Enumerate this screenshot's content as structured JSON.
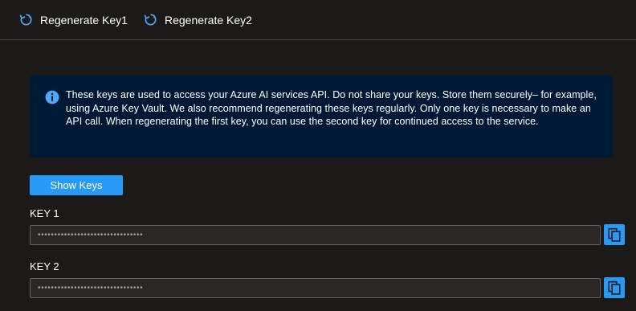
{
  "toolbar": {
    "regen1_label": "Regenerate Key1",
    "regen2_label": "Regenerate Key2"
  },
  "info": {
    "text": "These keys are used to access your Azure AI services API. Do not share your keys. Store them securely– for example, using Azure Key Vault. We also recommend regenerating these keys regularly. Only one key is necessary to make an API call. When regenerating the first key, you can use the second key for continued access to the service."
  },
  "show_keys_label": "Show Keys",
  "keys": [
    {
      "label": "KEY 1",
      "value": "••••••••••••••••••••••••••••••••"
    },
    {
      "label": "KEY 2",
      "value": "••••••••••••••••••••••••••••••••"
    }
  ],
  "colors": {
    "accent": "#2899f5",
    "background": "#1b1a19",
    "infobar": "#001a36"
  },
  "icons": {
    "regen": "refresh-icon",
    "info": "info-icon",
    "copy": "copy-icon"
  }
}
